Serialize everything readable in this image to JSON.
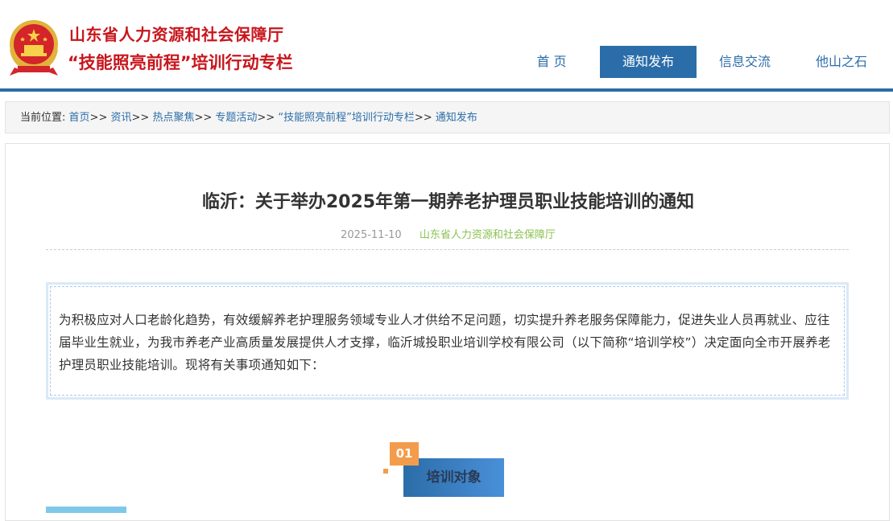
{
  "site": {
    "title_line1": "山东省人力资源和社会保障厅",
    "title_line2": "“技能照亮前程”培训行动专栏"
  },
  "nav": {
    "items": [
      {
        "label": "首 页"
      },
      {
        "label": "通知发布"
      },
      {
        "label": "信息交流"
      },
      {
        "label": "他山之石"
      }
    ],
    "active_index": 1
  },
  "breadcrumb": {
    "prefix": "当前位置:",
    "separator": ">>",
    "items": [
      {
        "label": "首页"
      },
      {
        "label": "资讯"
      },
      {
        "label": "热点聚焦"
      },
      {
        "label": "专题活动"
      },
      {
        "label": "“技能照亮前程”培训行动专栏"
      },
      {
        "label": "通知发布"
      }
    ]
  },
  "article": {
    "title": "临沂：关于举办2025年第一期养老护理员职业技能培训的通知",
    "date": "2025-11-10",
    "source": "山东省人力资源和社会保障厅",
    "intro": "为积极应对人口老龄化趋势，有效缓解养老护理服务领域专业人才供给不足问题，切实提升养老服务保障能力，促进失业人员再就业、应往届毕业生就业，为我市养老产业高质量发展提供人才支撑，临沂城投职业培训学校有限公司（以下简称“培训学校”）决定面向全市开展养老护理员职业技能培训。现将有关事项通知如下："
  },
  "section1": {
    "number": "01",
    "label": "培训对象"
  },
  "colors": {
    "brand_red": "#c8161d",
    "nav_blue": "#2b6da8",
    "source_green": "#8cc152",
    "accent_orange": "#f39c4b"
  },
  "icons": {
    "emblem": "national-emblem-icon"
  }
}
